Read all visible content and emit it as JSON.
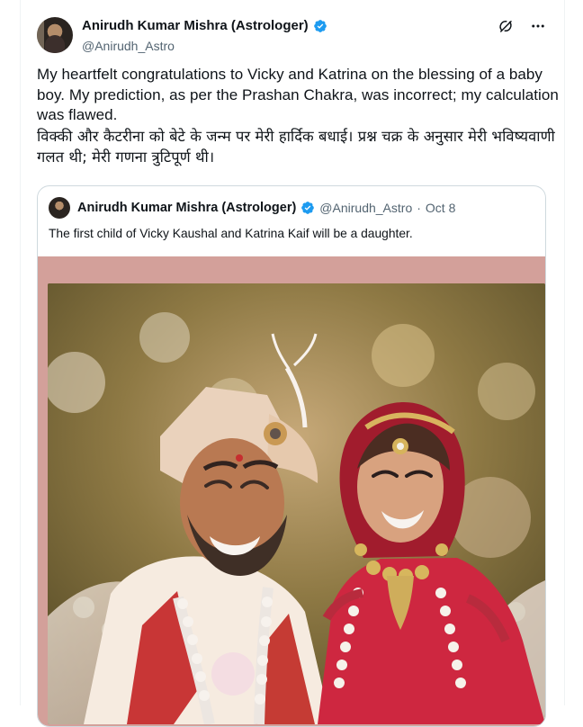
{
  "tweet": {
    "display_name": "Anirudh Kumar Mishra (Astrologer)",
    "handle": "@Anirudh_Astro",
    "text_en": "My heartfelt congratulations to Vicky and Katrina on the blessing of a baby boy. My prediction, as per the Prashan Chakra, was incorrect; my calculation was flawed.",
    "text_hi": "विक्की और कैटरीना को बेटे के जन्म पर मेरी हार्दिक बधाई। प्रश्न चक्र के अनुसार मेरी भविष्यवाणी गलत थी; मेरी गणना त्रुटिपूर्ण थी।"
  },
  "quote": {
    "display_name": "Anirudh Kumar Mishra (Astrologer)",
    "handle": "@Anirudh_Astro",
    "separator": "·",
    "date": "Oct 8",
    "text": "The first child of Vicky Kaushal and Katrina Kaif will be a daughter."
  },
  "icons": {
    "verified": "verified-badge-icon",
    "grok": "grok-icon",
    "more": "more-options-icon",
    "verified_color": "#1d9bf0"
  },
  "colors": {
    "text_primary": "#0f1419",
    "text_secondary": "#536471",
    "border": "#cfd9de",
    "photo_mat": "#d3a09a"
  }
}
